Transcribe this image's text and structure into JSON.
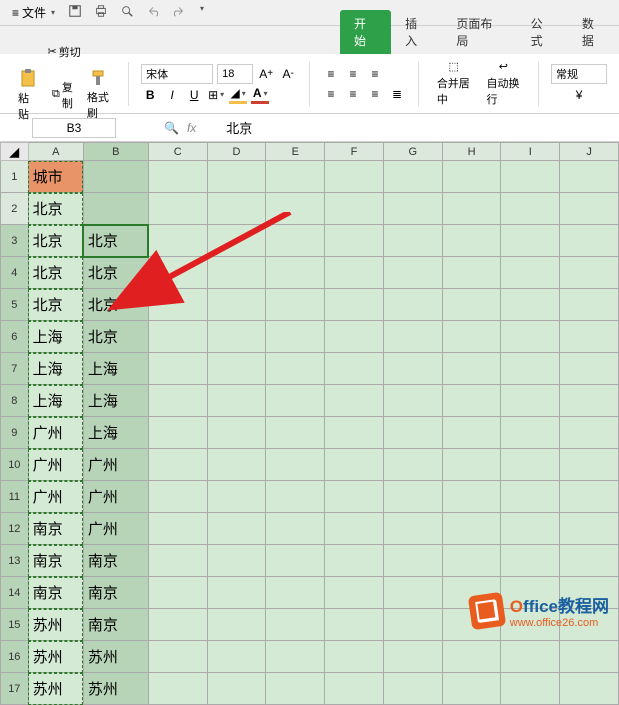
{
  "menubar": {
    "file_label": "文件",
    "qat": [
      "save",
      "print",
      "preview",
      "undo",
      "redo"
    ]
  },
  "tabs": [
    {
      "label": "开始",
      "active": true
    },
    {
      "label": "插入",
      "active": false
    },
    {
      "label": "页面布局",
      "active": false
    },
    {
      "label": "公式",
      "active": false
    },
    {
      "label": "数据",
      "active": false
    }
  ],
  "ribbon": {
    "cut": "剪切",
    "copy": "复制",
    "paste": "粘贴",
    "format_painter": "格式刷",
    "font_name": "宋体",
    "font_size": "18",
    "merge_center": "合并居中",
    "wrap_text": "自动换行",
    "style_group": "常规"
  },
  "formula_bar": {
    "name_box": "B3",
    "formula_value": "北京"
  },
  "columns": [
    "A",
    "B",
    "C",
    "D",
    "E",
    "F",
    "G",
    "H",
    "I",
    "J"
  ],
  "row_numbers": [
    1,
    2,
    3,
    4,
    5,
    6,
    7,
    8,
    9,
    10,
    11,
    12,
    13,
    14,
    15,
    16,
    17
  ],
  "cells": {
    "A1": "城市",
    "A2": "北京",
    "A3": "北京",
    "A4": "北京",
    "A5": "北京",
    "A6": "上海",
    "A7": "上海",
    "A8": "上海",
    "A9": "广州",
    "A10": "广州",
    "A11": "广州",
    "A12": "南京",
    "A13": "南京",
    "A14": "南京",
    "A15": "苏州",
    "A16": "苏州",
    "A17": "苏州",
    "B3": "北京",
    "B4": "北京",
    "B5": "北京",
    "B6": "北京",
    "B7": "上海",
    "B8": "上海",
    "B9": "上海",
    "B10": "广州",
    "B11": "广州",
    "B12": "广州",
    "B13": "南京",
    "B14": "南京",
    "B15": "南京",
    "B16": "苏州",
    "B17": "苏州"
  },
  "watermark": {
    "line1_part1": "O",
    "line1_part2": "ffice教程网",
    "line2": "www.office26.com"
  }
}
